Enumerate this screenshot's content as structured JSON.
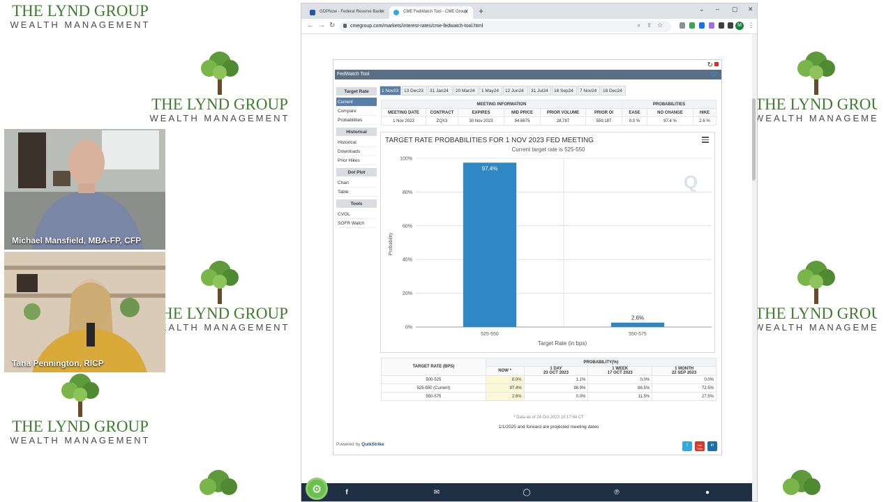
{
  "brand": {
    "name": "THE LYND GROUP",
    "tagline": "WEALTH MANAGEMENT"
  },
  "participants": [
    {
      "name": "Michael Mansfield, MBA-FP, CFP"
    },
    {
      "name": "Tana Pennington, RICP"
    }
  ],
  "browser": {
    "tabs": [
      {
        "title": "GDPNow - Federal Reserve Bank",
        "active": false
      },
      {
        "title": "CME FedWatch Tool - CME Group",
        "active": true
      }
    ],
    "url": "cmegroup.com/markets/interest-rates/cme-fedwatch-tool.html",
    "profile_initial": "M"
  },
  "fedwatch": {
    "title": "FedWatch Tool",
    "sidebar": [
      {
        "heading": "Target Rate",
        "items": [
          "Current",
          "Compare",
          "Probabilities"
        ]
      },
      {
        "heading": "Historical",
        "items": [
          "Historical",
          "Downloads",
          "Prior Hikes"
        ]
      },
      {
        "heading": "Dot Plot",
        "items": [
          "Chart",
          "Table"
        ]
      },
      {
        "heading": "Tools",
        "items": [
          "CVOL",
          "SOFR Watch"
        ]
      }
    ],
    "meeting_tabs": [
      "1 Nov23",
      "13 Dec23",
      "31 Jan24",
      "20 Mar24",
      "1 May24",
      "12 Jun24",
      "31 Jul24",
      "18 Sep24",
      "7 Nov24",
      "18 Dec24"
    ],
    "meeting_info": {
      "group_label": "MEETING INFORMATION",
      "prob_label": "PROBABILITIES",
      "headers": [
        "MEETING DATE",
        "CONTRACT",
        "EXPIRES",
        "MID PRICE",
        "PRIOR VOLUME",
        "PRIOR OI",
        "EASE",
        "NO CHANGE",
        "HIKE"
      ],
      "row": [
        "1 Nov 2023",
        "ZQX3",
        "30 Nov 2023",
        "94.6675",
        "28,787",
        "559,187",
        "0.0 %",
        "97.4 %",
        "2.6 %"
      ]
    },
    "probability_table": {
      "group_label": "PROBABILITY(%)",
      "target_header": "TARGET RATE (BPS)",
      "col_now": "NOW *",
      "col_1day": [
        "1 DAY",
        "23 OCT 2023"
      ],
      "col_1week": [
        "1 WEEK",
        "17 OCT 2023"
      ],
      "col_1month": [
        "1 MONTH",
        "22 SEP 2023"
      ],
      "rows": [
        [
          "500-525",
          "0.0%",
          "1.1%",
          "0.0%",
          "0.0%"
        ],
        [
          "525-550 (Current)",
          "97.4%",
          "98.9%",
          "88.5%",
          "72.5%"
        ],
        [
          "550-575",
          "2.6%",
          "0.0%",
          "11.5%",
          "27.5%"
        ]
      ],
      "note_date": "* Data as of 24 Oct 2023 10:17:54 CT",
      "note_projected": "1/1/2025 and forward are projected meeting dates"
    },
    "powered_by": "Powered by",
    "powered_brand": "QuikStrike",
    "social": [
      "t",
      "You Tube",
      "in"
    ]
  },
  "chart_data": {
    "type": "bar",
    "title": "TARGET RATE PROBABILITIES FOR 1 NOV 2023 FED MEETING",
    "subtitle": "Current target rate is 525-550",
    "xlabel": "Target Rate (in bps)",
    "ylabel": "Probability",
    "categories": [
      "525-550",
      "550-575"
    ],
    "values": [
      97.4,
      2.6
    ],
    "data_labels": [
      "97.4%",
      "2.6%"
    ],
    "ylim": [
      0,
      100
    ],
    "yticks": [
      "0%",
      "20%",
      "40%",
      "60%",
      "80%",
      "100%"
    ],
    "grid": true,
    "bar_color": "#2f87c4"
  }
}
